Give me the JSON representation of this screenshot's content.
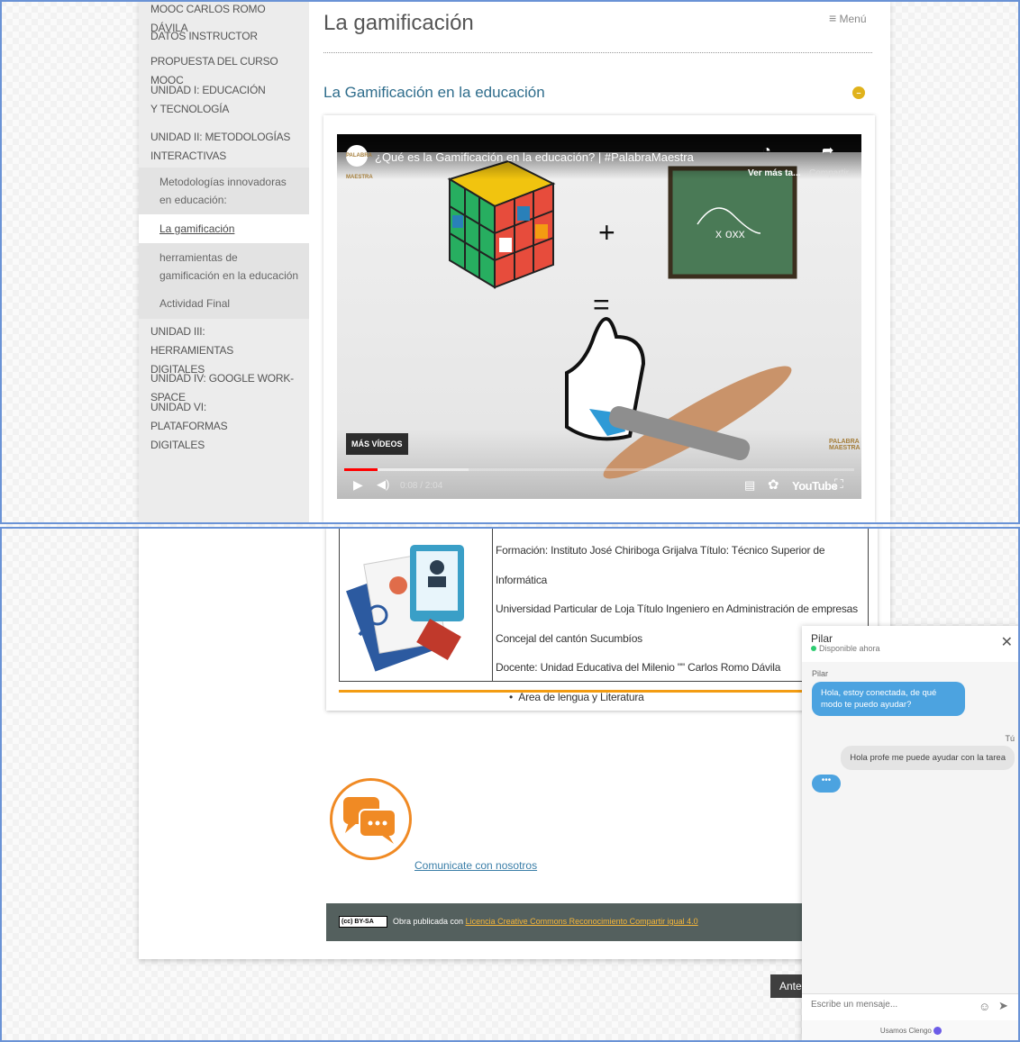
{
  "sidebar": {
    "items": [
      {
        "label": "MOOC CARLOS ROMO DÁVILA"
      },
      {
        "label": "DATOS INSTRUCTOR"
      },
      {
        "label": "PROPUESTA DEL CURSO MOOC"
      },
      {
        "label": "UNIDAD I: EDUCACIÓN Y TECNOLOGÍA"
      },
      {
        "label": "UNIDAD II: METODOLOGÍAS INTERACTIVAS"
      }
    ],
    "subitems": [
      {
        "label": "Metodologías innovadoras en educación:"
      },
      {
        "label": "La gamificación"
      },
      {
        "label": "herramientas de gamificación en la educación"
      },
      {
        "label": "Actividad Final"
      }
    ],
    "items_after": [
      {
        "label": "UNIDAD III: HERRAMIENTAS DIGITALES"
      },
      {
        "label": "UNIDAD IV: GOOGLE WORK-SPACE"
      },
      {
        "label": "UNIDAD VI: PLATAFORMAS DIGITALES"
      }
    ]
  },
  "header": {
    "title": "La gamificación",
    "menu_label": "Menú",
    "menu_icon": "≡"
  },
  "section": {
    "title": "La Gamificación en la educación"
  },
  "video": {
    "title": "¿Qué es la Gamificación en la educación? | #PalabraMaestra",
    "channel_logo_text": "PALABRA MAESTRA",
    "watch_later": "Ver más ta...",
    "share": "Compartir",
    "more_videos": "MÁS VÍDEOS",
    "time": "0:08 / 2:04",
    "progress": 0.065,
    "youtube_label": "YouTube",
    "watermark": "PALABRA MAESTRA",
    "plus": "+",
    "equals": "="
  },
  "bio": {
    "lines": [
      "Formación: Instituto José Chiriboga Grijalva Título: Técnico Superior de Informática",
      "Universidad Particular de Loja Título Ingeniero en Administración de empresas",
      "Concejal del cantón Sucumbíos",
      "Docente: Unidad Educativa del Milenio \"\" Carlos Romo Dávila"
    ],
    "bullet": "Área de lengua y Literatura"
  },
  "contact": {
    "label": "Comunicate con nosotros "
  },
  "license": {
    "badge": "(cc) BY-SA",
    "prefix": "Obra publicada con ",
    "link": "Licencia Creative Commons Reconocimiento Compartir igual 4.0"
  },
  "nav": {
    "prev_label": "Ante"
  },
  "chat": {
    "agent_name": "Pilar",
    "status": "Disponible ahora",
    "agent_label": "Pilar",
    "agent_message": "Hola, estoy conectada, de qué modo te puedo ayudar?",
    "user_label": "Tú",
    "user_message": "Hola profe me puede ayudar con la tarea",
    "typing": "•••",
    "input_placeholder": "Escribe un mensaje...",
    "footer": "Usamos Clengo"
  }
}
